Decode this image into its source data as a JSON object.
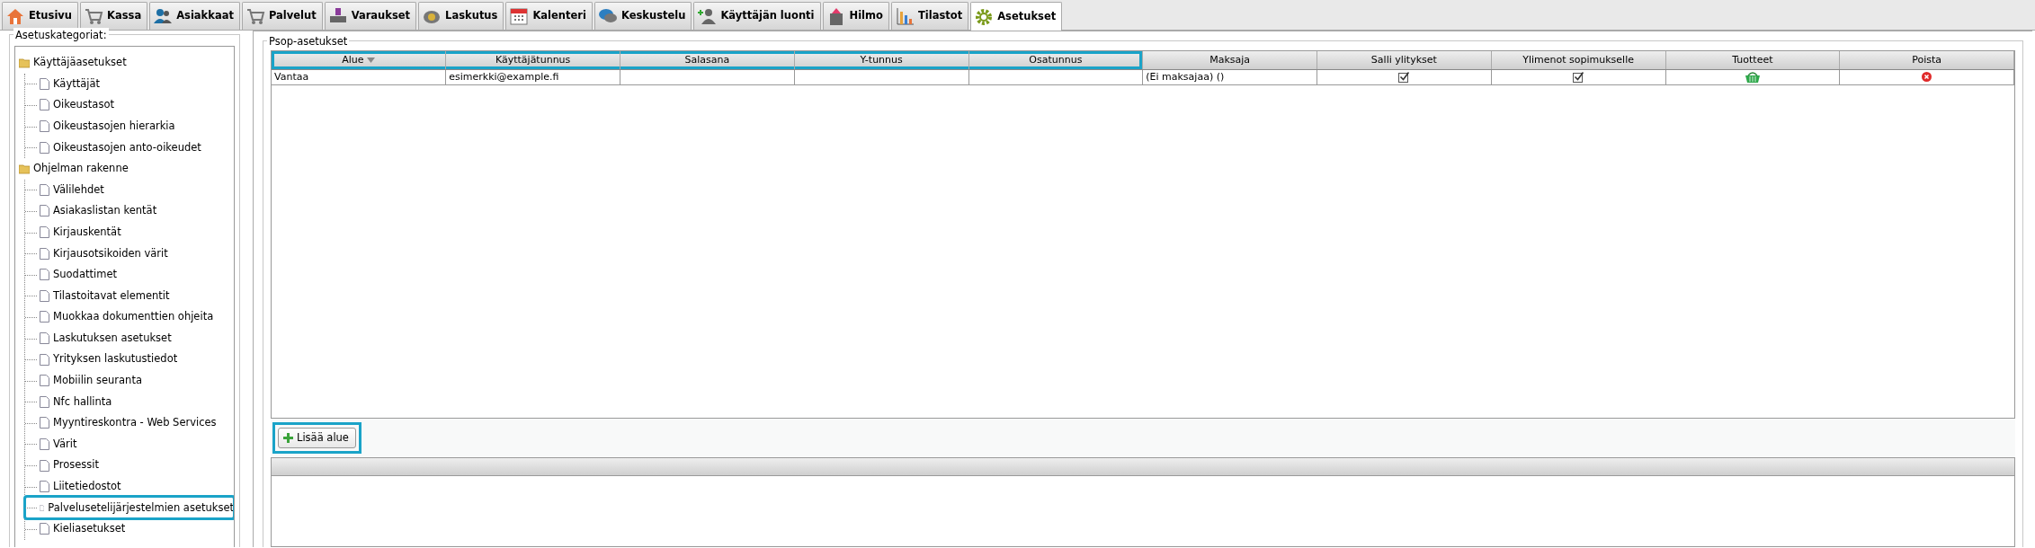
{
  "tabs": [
    {
      "label": "Etusivu",
      "selected": false
    },
    {
      "label": "Kassa",
      "selected": false
    },
    {
      "label": "Asiakkaat",
      "selected": false
    },
    {
      "label": "Palvelut",
      "selected": false
    },
    {
      "label": "Varaukset",
      "selected": false
    },
    {
      "label": "Laskutus",
      "selected": false
    },
    {
      "label": "Kalenteri",
      "selected": false
    },
    {
      "label": "Keskustelu",
      "selected": false
    },
    {
      "label": "Käyttäjän luonti",
      "selected": false
    },
    {
      "label": "Hilmo",
      "selected": false
    },
    {
      "label": "Tilastot",
      "selected": false
    },
    {
      "label": "Asetukset",
      "selected": true
    }
  ],
  "sidebar": {
    "title": "Asetuskategoriat:",
    "items": [
      {
        "label": "Käyttäjäasetukset",
        "children": [
          {
            "label": "Käyttäjät",
            "selected": false,
            "highlighted": false
          },
          {
            "label": "Oikeustasot",
            "selected": false,
            "highlighted": false
          },
          {
            "label": "Oikeustasojen hierarkia",
            "selected": false,
            "highlighted": false
          },
          {
            "label": "Oikeustasojen anto-oikeudet",
            "selected": false,
            "highlighted": false
          }
        ]
      },
      {
        "label": "Ohjelman rakenne",
        "children": [
          {
            "label": "Välilehdet",
            "selected": false,
            "highlighted": false
          },
          {
            "label": "Asiakaslistan kentät",
            "selected": false,
            "highlighted": false
          },
          {
            "label": "Kirjauskentät",
            "selected": false,
            "highlighted": false
          },
          {
            "label": "Kirjausotsikoiden värit",
            "selected": false,
            "highlighted": false
          },
          {
            "label": "Suodattimet",
            "selected": false,
            "highlighted": false
          },
          {
            "label": "Tilastoitavat elementit",
            "selected": false,
            "highlighted": false
          },
          {
            "label": "Muokkaa dokumenttien ohjeita",
            "selected": false,
            "highlighted": false
          },
          {
            "label": "Laskutuksen asetukset",
            "selected": false,
            "highlighted": false
          },
          {
            "label": "Yrityksen laskutustiedot",
            "selected": false,
            "highlighted": false
          },
          {
            "label": "Mobiilin seuranta",
            "selected": false,
            "highlighted": false
          },
          {
            "label": "Nfc hallinta",
            "selected": false,
            "highlighted": false
          },
          {
            "label": "Myyntireskontra - Web Services",
            "selected": false,
            "highlighted": false
          },
          {
            "label": "Värit",
            "selected": false,
            "highlighted": false
          },
          {
            "label": "Prosessit",
            "selected": false,
            "highlighted": false
          },
          {
            "label": "Liitetiedostot",
            "selected": false,
            "highlighted": false
          },
          {
            "label": "Palvelusetelijärjestelmien asetukset",
            "selected": true,
            "highlighted": true
          },
          {
            "label": "Kieliasetukset",
            "selected": false,
            "highlighted": false
          }
        ]
      }
    ]
  },
  "panel": {
    "title": "Psop-asetukset",
    "table": {
      "columns": [
        {
          "label": "Alue",
          "sorted": true,
          "highlighted": true
        },
        {
          "label": "Käyttäjätunnus",
          "sorted": false,
          "highlighted": true
        },
        {
          "label": "Salasana",
          "sorted": false,
          "highlighted": true
        },
        {
          "label": "Y-tunnus",
          "sorted": false,
          "highlighted": true
        },
        {
          "label": "Osatunnus",
          "sorted": false,
          "highlighted": true
        },
        {
          "label": "Maksaja",
          "sorted": false,
          "highlighted": false
        },
        {
          "label": "Salli ylitykset",
          "sorted": false,
          "highlighted": false
        },
        {
          "label": "Ylimenot sopimukselle",
          "sorted": false,
          "highlighted": false
        },
        {
          "label": "Tuotteet",
          "sorted": false,
          "highlighted": false
        },
        {
          "label": "Poista",
          "sorted": false,
          "highlighted": false
        }
      ],
      "rows": [
        {
          "alue": "Vantaa",
          "kayttajatunnus": "esimerkki@example.fi",
          "maksaja": "(Ei maksajaa) ()",
          "salli_ylitykset": true,
          "ylimenot": true
        }
      ]
    },
    "add_button": {
      "label": "Lisää alue",
      "highlighted": true
    }
  }
}
